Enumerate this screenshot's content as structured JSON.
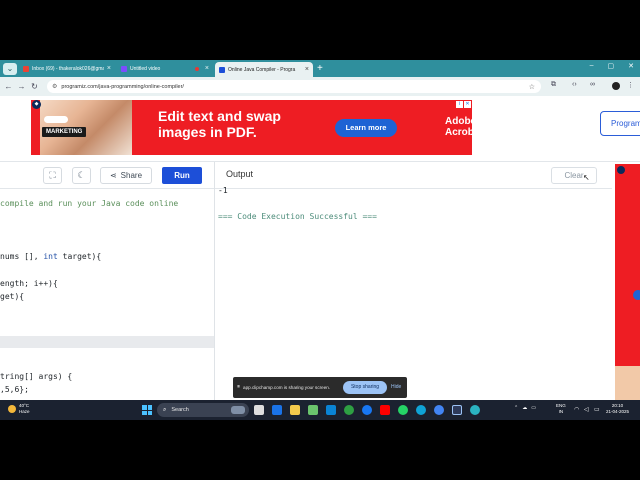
{
  "browser": {
    "tabs": [
      {
        "title": "Inbox (69) - thakeralok026@gma",
        "favicon_color": "#ea4335"
      },
      {
        "title": "Untitled video",
        "favicon_color": "#7c4dff"
      },
      {
        "title": "Online Java Compiler - Progra",
        "favicon_color": "#1d4fd8"
      }
    ],
    "url": "programiz.com/java-programming/online-compiler/"
  },
  "ad": {
    "marketing_label": "MARKETING",
    "headline": "Edit text and swap images in PDF.",
    "cta": "Learn more",
    "brand": "Adobe Acrobat"
  },
  "header": {
    "programiz_button": "Programiz"
  },
  "toolbar": {
    "share_label": "Share",
    "run_label": "Run",
    "output_label": "Output",
    "clear_label": "Clear"
  },
  "editor": {
    "comment": "compile and run your Java code online",
    "lines": [
      {
        "pre": "nums [], ",
        "kw": "int",
        "post": " target){"
      },
      {
        "pre": "ength; i++){",
        "kw": "",
        "post": ""
      },
      {
        "pre": "get){",
        "kw": "",
        "post": ""
      },
      {
        "pre": "tring[] args) {",
        "kw": "",
        "post": ""
      },
      {
        "pre": ",5,6};",
        "kw": "",
        "post": ""
      }
    ]
  },
  "output": {
    "result": "-1",
    "status": "=== Code Execution Successful ==="
  },
  "sharing": {
    "message": "app.clipchamp.com is sharing your screen.",
    "stop_label": "Stop sharing",
    "hide_label": "Hide"
  },
  "taskbar": {
    "temperature": "40°C",
    "condition": "Haze",
    "search_label": "Search",
    "lang_top": "ENG",
    "lang_bottom": "IN",
    "time": "20:10",
    "date": "21-04-2025"
  },
  "colors": {
    "tabbar": "#2f8f9d",
    "run_button": "#1d4fd8",
    "ad_red": "#ee1d23",
    "taskbar": "#1b2230"
  }
}
